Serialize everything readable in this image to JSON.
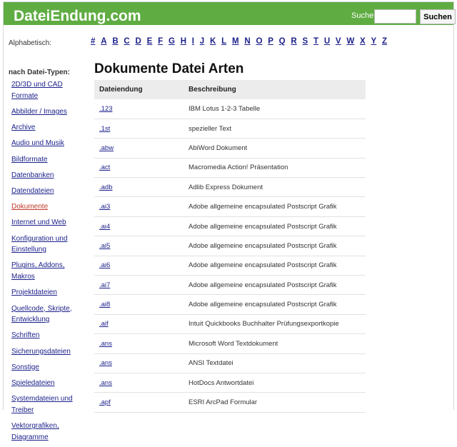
{
  "header": {
    "logo": "DateiEndung.com",
    "search_label": "Suche",
    "search_value": "",
    "search_button": "Suchen"
  },
  "alphabet": {
    "label": "Alphabetisch:",
    "letters": [
      "#",
      "A",
      "B",
      "C",
      "D",
      "E",
      "F",
      "G",
      "H",
      "I",
      "J",
      "K",
      "L",
      "M",
      "N",
      "O",
      "P",
      "Q",
      "R",
      "S",
      "T",
      "U",
      "V",
      "W",
      "X",
      "Y",
      "Z"
    ]
  },
  "sidebar": {
    "heading": "nach Datei-Typen:",
    "active": "Dokumente",
    "items": [
      "2D/3D und CAD Formate",
      "Abbilder / Images",
      "Archive",
      "Audio und Musik",
      "Bildformate",
      "Datenbanken",
      "Datendateien",
      "Dokumente",
      "Internet und Web",
      "Konfiguration und Einstellung",
      "Plugins, Addons, Makros",
      "Projektdateien",
      "Quellcode, Skripte, Entwicklung",
      "Schriften",
      "Sicherungsdateien",
      "Sonstige",
      "Spieledateien",
      "Systemdateien und Treiber",
      "Vektorgrafiken, Diagramme"
    ]
  },
  "main": {
    "title": "Dokumente Datei Arten",
    "columns": [
      "Dateiendung",
      "Beschreibung"
    ],
    "rows": [
      [
        ".123",
        "IBM Lotus 1-2-3 Tabelle"
      ],
      [
        ".1st",
        "spezieller Text"
      ],
      [
        ".abw",
        "AbiWord Dokument"
      ],
      [
        ".act",
        "Macromedia Action! Präsentation"
      ],
      [
        ".adb",
        "Adlib Express Dokument"
      ],
      [
        ".ai3",
        "Adobe allgemeine encapsulated Postscript Grafik"
      ],
      [
        ".ai4",
        "Adobe allgemeine encapsulated Postscript Grafik"
      ],
      [
        ".ai5",
        "Adobe allgemeine encapsulated Postscript Grafik"
      ],
      [
        ".ai6",
        "Adobe allgemeine encapsulated Postscript Grafik"
      ],
      [
        ".ai7",
        "Adobe allgemeine encapsulated Postscript Grafik"
      ],
      [
        ".ai8",
        "Adobe allgemeine encapsulated Postscript Grafik"
      ],
      [
        ".aif",
        "Intuit Quickbooks Buchhalter Prüfungsexportkopie"
      ],
      [
        ".ans",
        "Microsoft Word Textdokument"
      ],
      [
        ".ans",
        "ANSI Textdatei"
      ],
      [
        ".ans",
        "HotDocs Antwortdatei"
      ],
      [
        ".apf",
        "ESRI ArcPad Formular"
      ]
    ]
  },
  "colors": {
    "header_bg": "#5fac43",
    "link": "#1b1f8a",
    "active_link": "#c0392b",
    "table_header_bg": "#ececec"
  }
}
